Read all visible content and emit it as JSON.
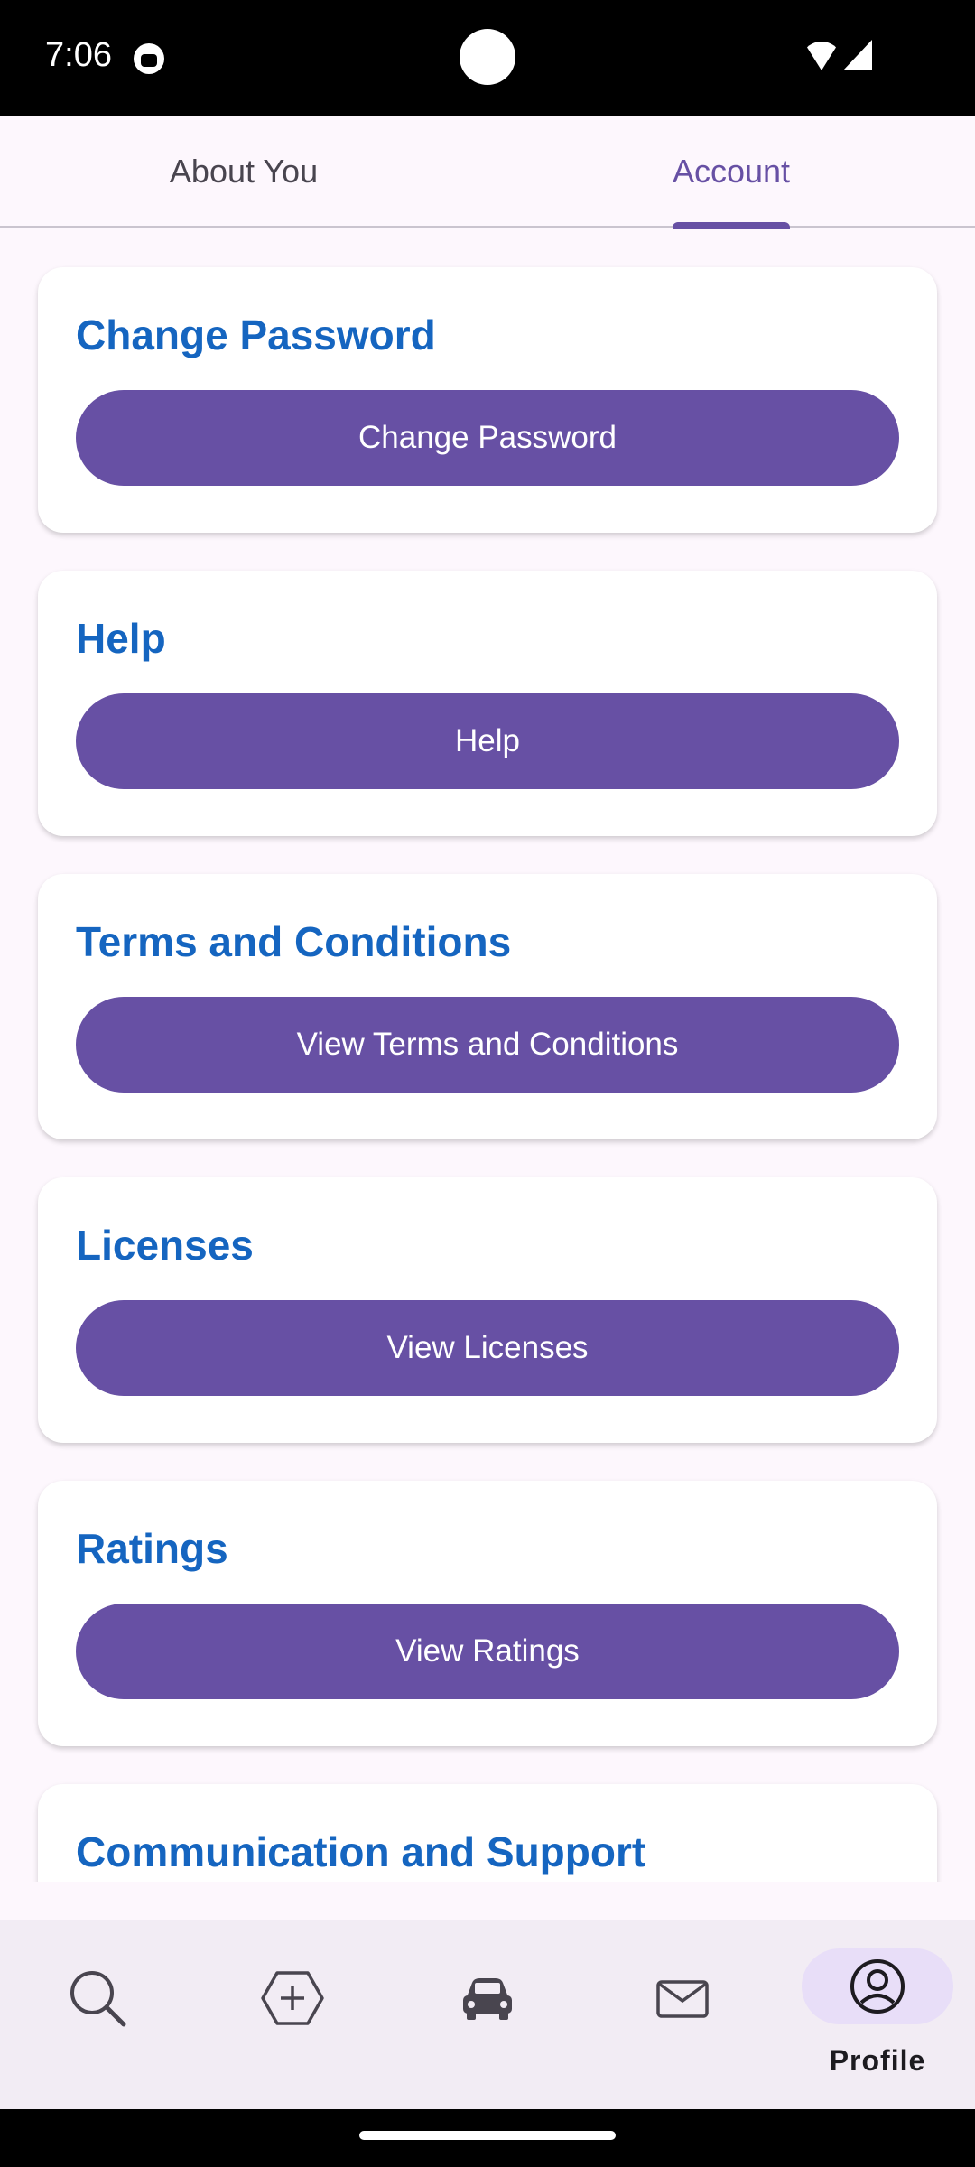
{
  "status_bar": {
    "time": "7:06"
  },
  "tabs": [
    {
      "label": "About You",
      "selected": false
    },
    {
      "label": "Account",
      "selected": true
    }
  ],
  "cards": [
    {
      "title": "Change Password",
      "button": "Change Password"
    },
    {
      "title": "Help",
      "button": "Help"
    },
    {
      "title": "Terms and Conditions",
      "button": "View Terms and Conditions"
    },
    {
      "title": "Licenses",
      "button": "View Licenses"
    },
    {
      "title": "Ratings",
      "button": "View Ratings"
    },
    {
      "title": "Communication and Support",
      "button": ""
    }
  ],
  "bottom_nav": {
    "items": [
      {
        "icon": "search-icon"
      },
      {
        "icon": "add-hexagon-icon"
      },
      {
        "icon": "car-icon"
      },
      {
        "icon": "mail-icon"
      },
      {
        "icon": "profile-icon",
        "label": "Profile",
        "selected": true
      }
    ]
  },
  "colors": {
    "accent": "#6750a4",
    "title_blue": "#1565c0",
    "background": "#fdf7fd",
    "nav_background": "#f2ecf4",
    "selected_pill": "#e8def8"
  }
}
